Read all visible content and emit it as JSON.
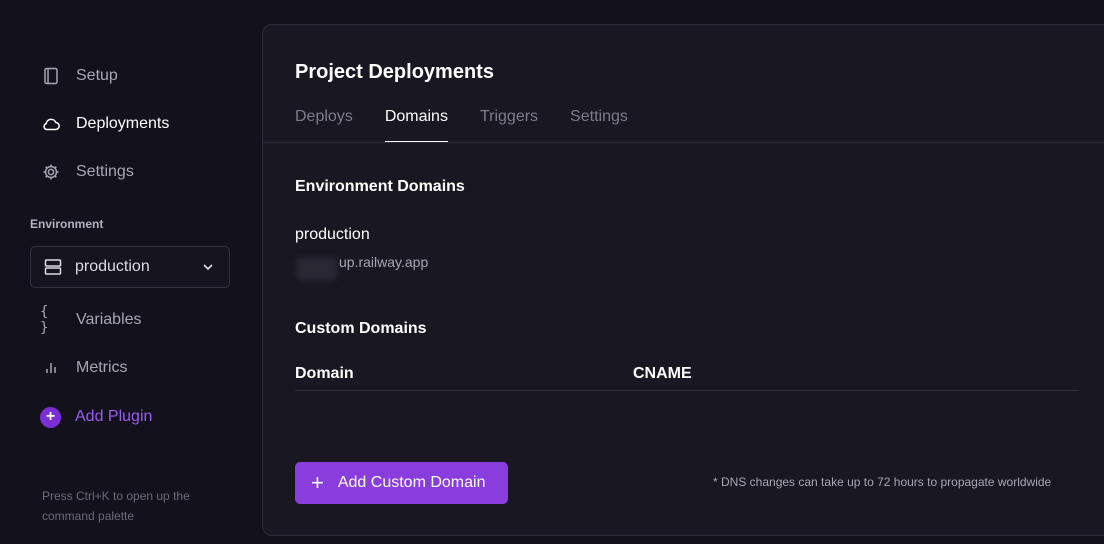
{
  "sidebar": {
    "nav": [
      {
        "label": "Setup",
        "icon": "book-icon",
        "active": false
      },
      {
        "label": "Deployments",
        "icon": "cloud-icon",
        "active": true
      },
      {
        "label": "Settings",
        "icon": "gear-icon",
        "active": false
      }
    ],
    "environment_label": "Environment",
    "environment_select": {
      "value": "production",
      "icon": "server-icon"
    },
    "secondary_nav": [
      {
        "label": "Variables",
        "icon": "braces-icon"
      },
      {
        "label": "Metrics",
        "icon": "bar-chart-icon"
      }
    ],
    "add_plugin_label": "Add Plugin",
    "hint": "Press Ctrl+K to open up the command palette"
  },
  "main": {
    "title": "Project Deployments",
    "tabs": [
      {
        "label": "Deploys",
        "active": false
      },
      {
        "label": "Domains",
        "active": true
      },
      {
        "label": "Triggers",
        "active": false
      },
      {
        "label": "Settings",
        "active": false
      }
    ],
    "environment_domains": {
      "title": "Environment Domains",
      "environment": "production",
      "domain": "up.railway.app"
    },
    "custom_domains": {
      "title": "Custom Domains",
      "columns": [
        "Domain",
        "CNAME"
      ]
    },
    "add_button_label": "Add Custom Domain",
    "dns_note": "* DNS changes can take up to 72 hours to propagate worldwide"
  },
  "colors": {
    "background": "#13111c",
    "panel": "#191722",
    "accent": "#8a3ddd",
    "plugin_text": "#9b5cf0"
  }
}
